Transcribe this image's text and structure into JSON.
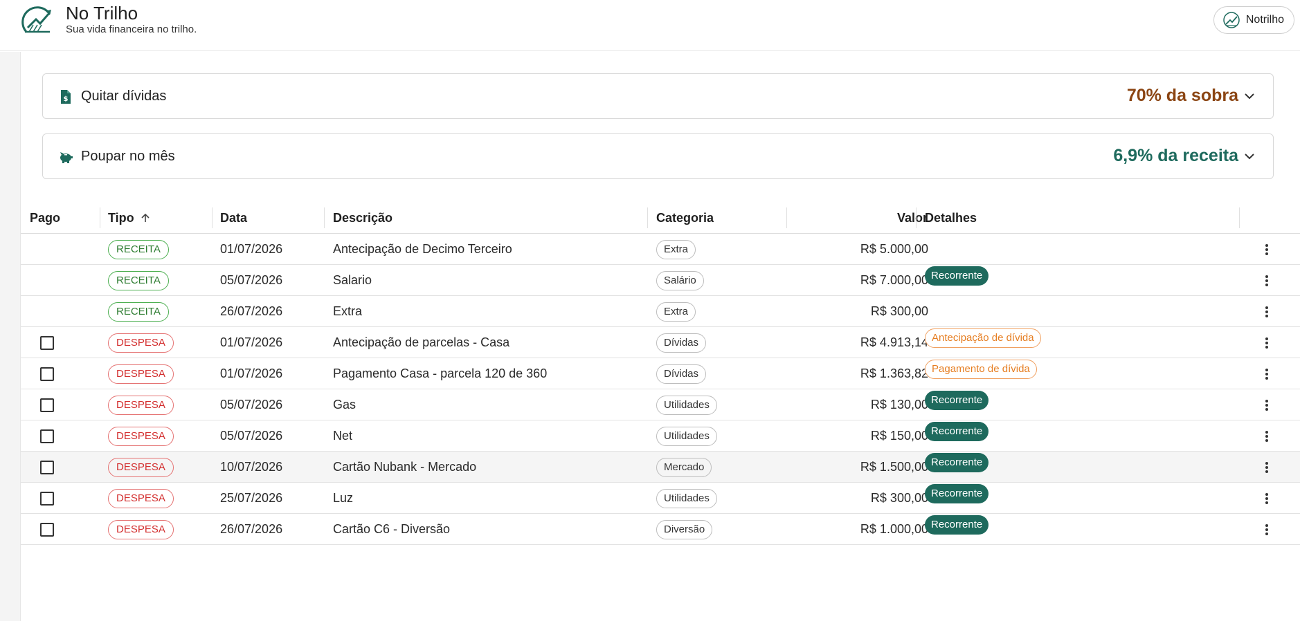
{
  "header": {
    "app_name": "No Trilho",
    "tagline": "Sua vida financeira no trilho.",
    "user_name": "Notrilho"
  },
  "cards": [
    {
      "label": "Quitar dívidas",
      "value": "70% da sobra",
      "value_color": "#8b4513",
      "icon": "file-dollar-icon"
    },
    {
      "label": "Poupar no mês",
      "value": "6,9% da receita",
      "value_color": "#1e6a5d",
      "icon": "piggy-bank-icon"
    }
  ],
  "table": {
    "headers": {
      "pago": "Pago",
      "tipo": "Tipo",
      "data": "Data",
      "descricao": "Descrição",
      "categoria": "Categoria",
      "valor": "Valor",
      "detalhes": "Detalhes"
    },
    "sort_column": "tipo",
    "sort_direction": "ascending",
    "rows": [
      {
        "has_checkbox": false,
        "tipo": "RECEITA",
        "data": "01/07/2026",
        "descricao": "Antecipação de Decimo Terceiro",
        "categoria": "Extra",
        "valor": "R$ 5.000,00",
        "detalhe": ""
      },
      {
        "has_checkbox": false,
        "tipo": "RECEITA",
        "data": "05/07/2026",
        "descricao": "Salario",
        "categoria": "Salário",
        "valor": "R$ 7.000,00",
        "detalhe": "Recorrente"
      },
      {
        "has_checkbox": false,
        "tipo": "RECEITA",
        "data": "26/07/2026",
        "descricao": "Extra",
        "categoria": "Extra",
        "valor": "R$ 300,00",
        "detalhe": ""
      },
      {
        "has_checkbox": true,
        "tipo": "DESPESA",
        "data": "01/07/2026",
        "descricao": "Antecipação de parcelas - Casa",
        "categoria": "Dívidas",
        "valor": "R$ 4.913,14",
        "detalhe": "Antecipação de dívida"
      },
      {
        "has_checkbox": true,
        "tipo": "DESPESA",
        "data": "01/07/2026",
        "descricao": "Pagamento Casa - parcela 120 de 360",
        "categoria": "Dívidas",
        "valor": "R$ 1.363,82",
        "detalhe": "Pagamento de dívida"
      },
      {
        "has_checkbox": true,
        "tipo": "DESPESA",
        "data": "05/07/2026",
        "descricao": "Gas",
        "categoria": "Utilidades",
        "valor": "R$ 130,00",
        "detalhe": "Recorrente"
      },
      {
        "has_checkbox": true,
        "tipo": "DESPESA",
        "data": "05/07/2026",
        "descricao": "Net",
        "categoria": "Utilidades",
        "valor": "R$ 150,00",
        "detalhe": "Recorrente"
      },
      {
        "has_checkbox": true,
        "tipo": "DESPESA",
        "data": "10/07/2026",
        "descricao": "Cartão Nubank - Mercado",
        "categoria": "Mercado",
        "valor": "R$ 1.500,00",
        "detalhe": "Recorrente",
        "highlighted": true
      },
      {
        "has_checkbox": true,
        "tipo": "DESPESA",
        "data": "25/07/2026",
        "descricao": "Luz",
        "categoria": "Utilidades",
        "valor": "R$ 300,00",
        "detalhe": "Recorrente"
      },
      {
        "has_checkbox": true,
        "tipo": "DESPESA",
        "data": "26/07/2026",
        "descricao": "Cartão C6 - Diversão",
        "categoria": "Diversão",
        "valor": "R$ 1.000,00",
        "detalhe": "Recorrente"
      }
    ]
  },
  "colors": {
    "brand_green": "#1e6a5d",
    "receita": "#2e7d32",
    "despesa": "#d32f2f",
    "divida_orange": "#e67e22",
    "sobra_brown": "#8b4513"
  }
}
